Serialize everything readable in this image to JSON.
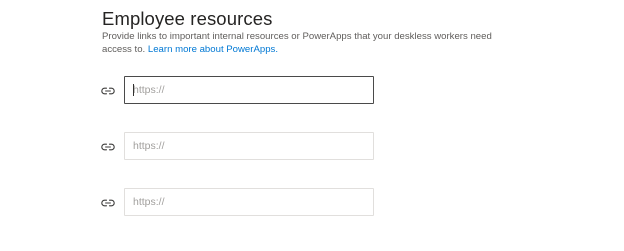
{
  "section": {
    "title": "Employee resources",
    "description": "Provide links to important internal resources or PowerApps that your deskless workers need access to.",
    "learn_more_link": "Learn more about PowerApps."
  },
  "resources": [
    {
      "placeholder": "https://",
      "value": ""
    },
    {
      "placeholder": "https://",
      "value": ""
    },
    {
      "placeholder": "https://",
      "value": ""
    }
  ],
  "icons": {
    "link": "link-icon"
  },
  "colors": {
    "link": "#0078d4",
    "text_primary": "#252423",
    "text_secondary": "#605e5c",
    "input_border": "#e1dfdd",
    "input_border_focused": "#4a4a4a",
    "placeholder": "#a19f9d"
  }
}
